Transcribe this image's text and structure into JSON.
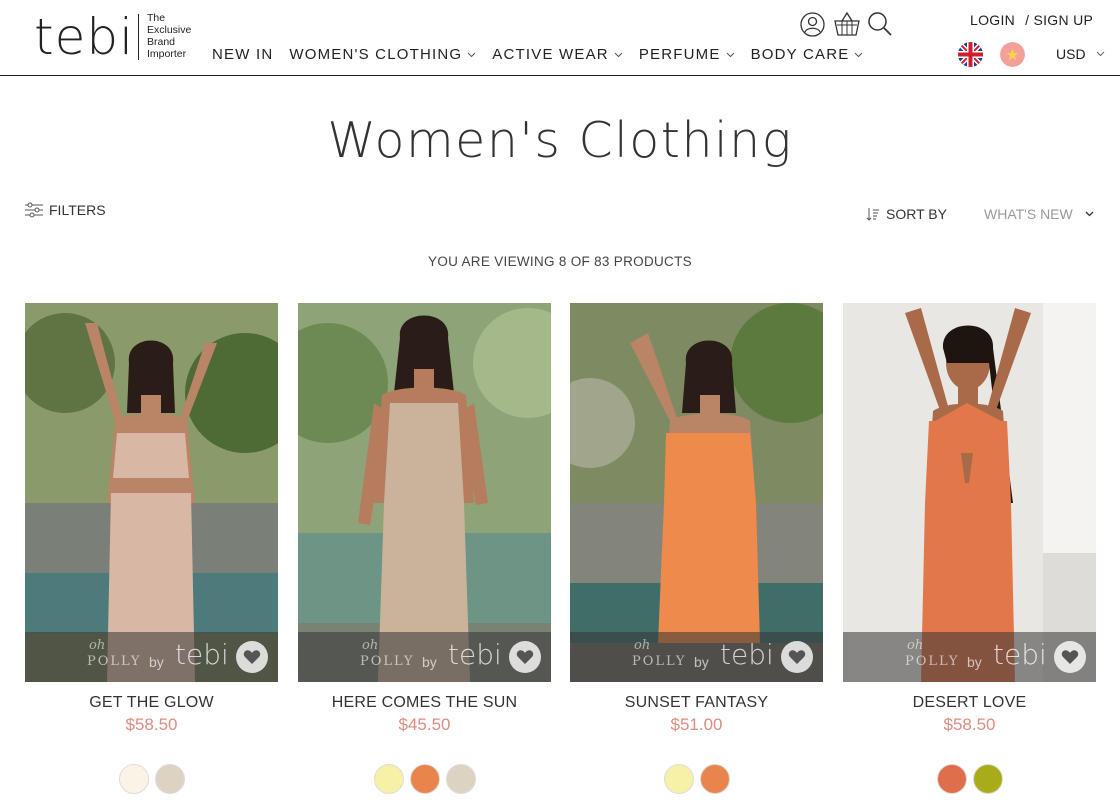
{
  "header": {
    "logo": "tebi",
    "tagline": [
      "The",
      "Exclusive",
      "Brand",
      "Importer"
    ],
    "nav": [
      {
        "label": "NEW IN",
        "dropdown": false
      },
      {
        "label": "WOMEN'S CLOTHING",
        "dropdown": true
      },
      {
        "label": "ACTIVE WEAR",
        "dropdown": true
      },
      {
        "label": "PERFUME",
        "dropdown": true
      },
      {
        "label": "BODY CARE",
        "dropdown": true
      }
    ],
    "icons": [
      "user-icon",
      "basket-icon",
      "search-icon"
    ],
    "login": "LOGIN",
    "signup": "/ SIGN UP",
    "currency": "USD"
  },
  "page": {
    "title": "Women's Clothing",
    "filters_label": "FILTERS",
    "sort_label": "SORT BY",
    "sort_value": "WHAT'S NEW",
    "viewing_text": "YOU ARE VIEWING 8 OF 83 PRODUCTS"
  },
  "colors": {
    "price": "#e08a80",
    "text": "#222222"
  },
  "products": [
    {
      "name": "GET THE GLOW",
      "price": "$58.50",
      "brand": "oh POLLY by tebi",
      "dress_color": "#d8b8a4",
      "swatches": [
        "#fbf3e6",
        "#ddd3c3"
      ]
    },
    {
      "name": "HERE COMES THE SUN",
      "price": "$45.50",
      "brand": "oh POLLY by tebi",
      "dress_color": "#cbb29a",
      "swatches": [
        "#f6f1a6",
        "#e8844c",
        "#ddd3c3"
      ]
    },
    {
      "name": "SUNSET FANTASY",
      "price": "$51.00",
      "brand": "oh POLLY by tebi",
      "dress_color": "#ee8a4c",
      "swatches": [
        "#f6f1a6",
        "#e8844c"
      ]
    },
    {
      "name": "DESERT LOVE",
      "price": "$58.50",
      "brand": "oh POLLY by tebi",
      "dress_color": "#e2774a",
      "swatches": [
        "#de6e4c",
        "#a8ac18"
      ]
    }
  ]
}
